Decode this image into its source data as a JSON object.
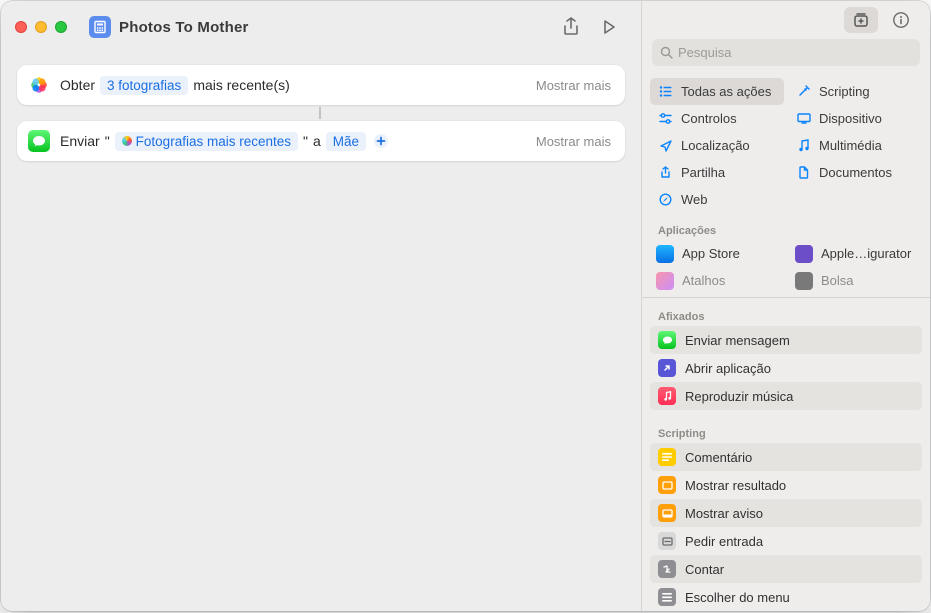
{
  "window": {
    "title": "Photos To Mother"
  },
  "toolbar": {
    "share_icon": "share-icon",
    "play_icon": "play-icon"
  },
  "actions": {
    "card1": {
      "verb": "Obter",
      "param": "3 fotografias",
      "suffix": "mais recente(s)",
      "more": "Mostrar mais"
    },
    "card2": {
      "verb": "Enviar",
      "quote_open": "\"",
      "token": "Fotografias mais recentes",
      "quote_close": "\"",
      "to_label": "a",
      "recipient": "Mãe",
      "more": "Mostrar mais"
    }
  },
  "sidebar": {
    "search_placeholder": "Pesquisa",
    "categories": [
      {
        "label": "Todas as ações"
      },
      {
        "label": "Scripting"
      },
      {
        "label": "Controlos"
      },
      {
        "label": "Dispositivo"
      },
      {
        "label": "Localização"
      },
      {
        "label": "Multimédia"
      },
      {
        "label": "Partilha"
      },
      {
        "label": "Documentos"
      },
      {
        "label": "Web"
      }
    ],
    "apps_header": "Aplicações",
    "apps": [
      {
        "label": "App Store"
      },
      {
        "label": "Apple…igurator"
      },
      {
        "label": "Atalhos"
      },
      {
        "label": "Bolsa"
      }
    ],
    "pinned_header": "Afixados",
    "pinned": [
      {
        "label": "Enviar mensagem"
      },
      {
        "label": "Abrir aplicação"
      },
      {
        "label": "Reproduzir música"
      }
    ],
    "scripting_header": "Scripting",
    "scripting": [
      {
        "label": "Comentário"
      },
      {
        "label": "Mostrar resultado"
      },
      {
        "label": "Mostrar aviso"
      },
      {
        "label": "Pedir entrada"
      },
      {
        "label": "Contar"
      },
      {
        "label": "Escolher do menu"
      }
    ]
  }
}
